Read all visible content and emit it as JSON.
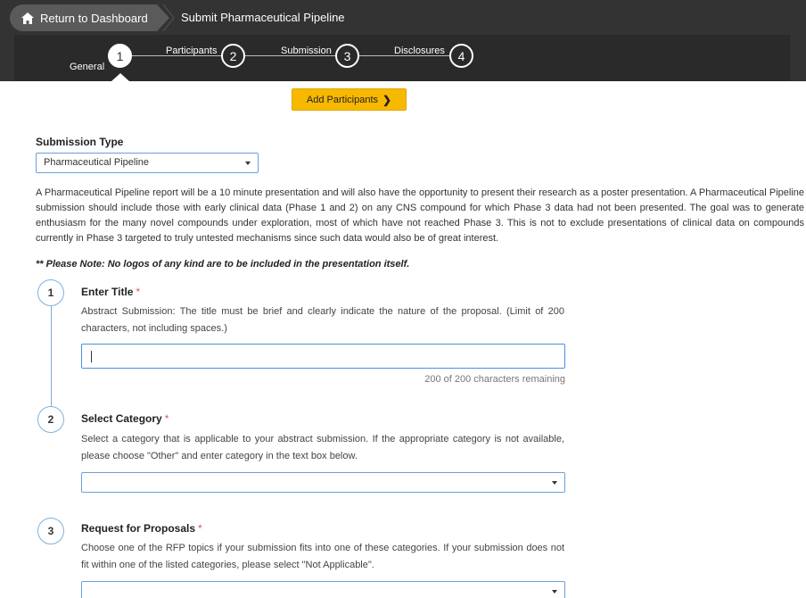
{
  "header": {
    "return_label": "Return to Dashboard",
    "page_title": "Submit Pharmaceutical Pipeline"
  },
  "steps": [
    {
      "number": "1",
      "label": "General",
      "active": true
    },
    {
      "number": "2",
      "label": "Participants",
      "active": false
    },
    {
      "number": "3",
      "label": "Submission",
      "active": false
    },
    {
      "number": "4",
      "label": "Disclosures",
      "active": false
    }
  ],
  "add_participants_label": "Add Participants",
  "submission_type": {
    "label": "Submission Type",
    "selected": "Pharmaceutical Pipeline"
  },
  "description": "A Pharmaceutical Pipeline report will be a 10 minute presentation and will also have the opportunity to present their research as a poster presentation. A Pharmaceutical Pipeline submission should include those with early clinical data (Phase 1 and 2) on any CNS compound for which Phase 3 data had not been presented. The goal was to generate enthusiasm for the many novel compounds under exploration, most of which have not reached Phase 3. This is not to exclude presentations of clinical data on compounds currently in Phase 3 targeted to truly untested mechanisms since such data would also be of great interest.",
  "note": "** Please Note: No logos of any kind are to be included in the presentation itself.",
  "questions": [
    {
      "number": "1",
      "title": "Enter Title",
      "required_mark": "*",
      "help": "Abstract Submission: The title must be brief and clearly indicate the nature of the proposal. (Limit of 200 characters, not including spaces.)",
      "value": "",
      "remaining": "200 of 200 characters remaining"
    },
    {
      "number": "2",
      "title": "Select Category",
      "required_mark": "*",
      "help": "Select a category that is applicable to your abstract submission. If the appropriate category is not available, please choose \"Other\" and enter category in the text box below.",
      "selected": ""
    },
    {
      "number": "3",
      "title": "Request for Proposals",
      "required_mark": "*",
      "help": "Choose one of the RFP topics if your submission fits into one of these categories. If your submission does not fit within one of the listed categories, please select \"Not Applicable\".",
      "selected": ""
    }
  ],
  "colors": {
    "header_bg": "#333333",
    "stepbar_bg": "#2a2a2a",
    "accent_button": "#f7b800",
    "input_border": "#4a90d9",
    "required": "#e05555"
  },
  "icons": {
    "home": "home-icon",
    "chevron_right": "chevron-right-icon",
    "dropdown": "caret-down-icon"
  }
}
